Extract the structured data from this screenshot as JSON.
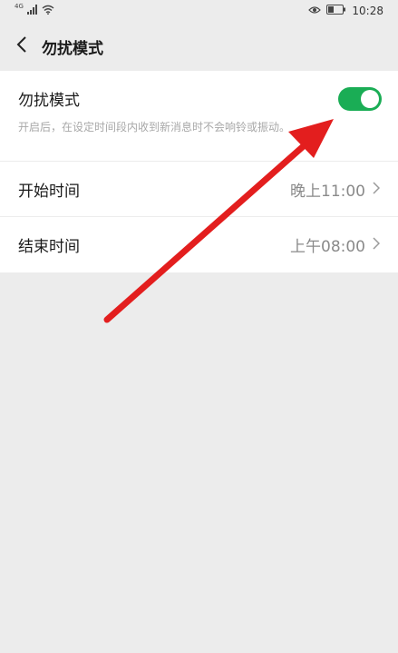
{
  "status_bar": {
    "network": "4G",
    "time": "10:28"
  },
  "header": {
    "title": "勿扰模式"
  },
  "settings": {
    "dnd": {
      "label": "勿扰模式",
      "description": "开启后，在设定时间段内收到新消息时不会响铃或振动。",
      "enabled": true
    },
    "start_time": {
      "label": "开始时间",
      "value": "晚上11:00"
    },
    "end_time": {
      "label": "结束时间",
      "value": "上午08:00"
    }
  },
  "colors": {
    "toggle_on": "#1aad55",
    "annotation_arrow": "#e31e1e",
    "background": "#ececec"
  }
}
